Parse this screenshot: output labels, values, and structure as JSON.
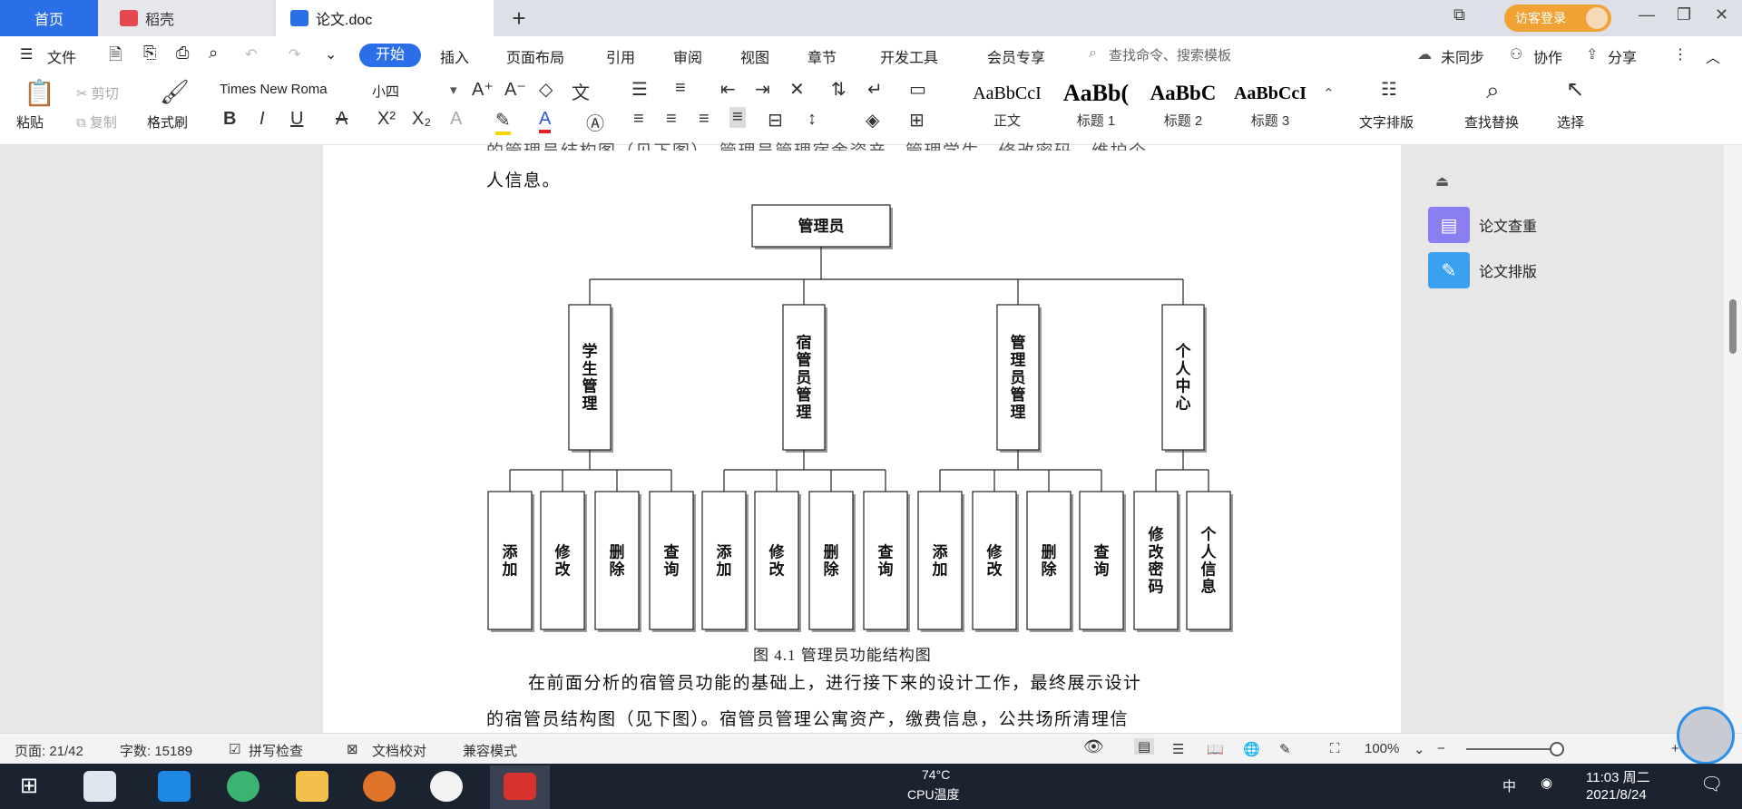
{
  "tabs": {
    "home": "首页",
    "daoke": "稻壳",
    "doc": "论文.doc",
    "add": "+"
  },
  "window": {
    "login": "访客登录"
  },
  "menu": {
    "file": "文件",
    "items": [
      "开始",
      "插入",
      "页面布局",
      "引用",
      "审阅",
      "视图",
      "章节",
      "开发工具",
      "会员专享"
    ],
    "search": "查找命令、搜索模板",
    "sync": "未同步",
    "collab": "协作",
    "share": "分享"
  },
  "ribbon": {
    "paste": "粘贴",
    "cut": "剪切",
    "copy": "复制",
    "format_painter": "格式刷",
    "font_name": "Times New Roma",
    "font_size": "小四",
    "bold": "B",
    "italic": "I",
    "underline": "U",
    "styles": [
      {
        "preview": "AaBbCcI",
        "name": "正文"
      },
      {
        "preview": "AaBb(",
        "name": "标题 1"
      },
      {
        "preview": "AaBbC",
        "name": "标题 2"
      },
      {
        "preview": "AaBbCcI",
        "name": "标题 3"
      }
    ],
    "text_layout": "文字排版",
    "find_replace": "查找替换",
    "select": "选择"
  },
  "document": {
    "line_prev": "的管理员结构图（见下图）。管理员管理宿舍资产，管理学生，修改密码、维护个",
    "line0": "人信息。",
    "diagram": {
      "root": "管理员",
      "modules": [
        {
          "name": "学生管理",
          "children": [
            "添加",
            "修改",
            "删除",
            "查询"
          ]
        },
        {
          "name": "宿管员管理",
          "children": [
            "添加",
            "修改",
            "删除",
            "查询"
          ]
        },
        {
          "name": "管理员管理",
          "children": [
            "添加",
            "修改",
            "删除",
            "查询"
          ]
        },
        {
          "name": "个人中心",
          "children": [
            "修改密码",
            "个人信息"
          ]
        }
      ]
    },
    "caption": "图 4.1  管理员功能结构图",
    "para1": "在前面分析的宿管员功能的基础上，进行接下来的设计工作，最终展示设计",
    "para2": "的宿管员结构图（见下图）。宿管员管理公寓资产，缴费信息，公共场所清理信"
  },
  "sidepanel": {
    "items": [
      "论文查重",
      "论文排版"
    ]
  },
  "status": {
    "page": "页面: 21/42",
    "words": "字数: 15189",
    "spell": "拼写检查",
    "proof": "文档校对",
    "compat": "兼容模式",
    "zoom": "100%"
  },
  "taskbar": {
    "temp": "74°C",
    "cpu": "CPU温度",
    "ime": "中",
    "time": "11:03 周二",
    "date": "2021/8/24"
  }
}
